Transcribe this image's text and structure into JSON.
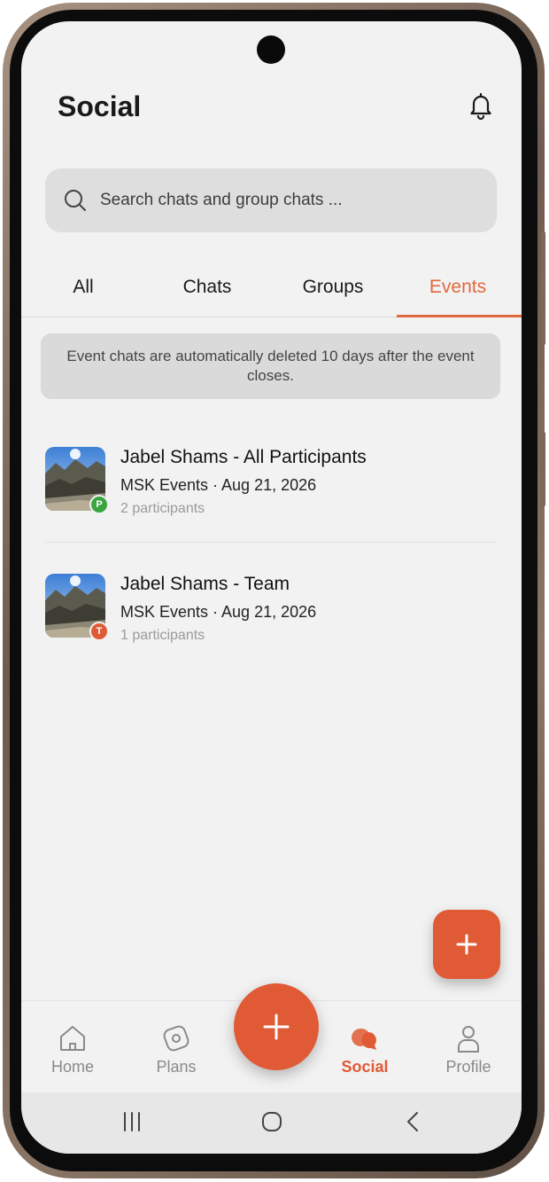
{
  "header": {
    "title": "Social",
    "notification_icon": "bell-icon"
  },
  "search": {
    "placeholder": "Search chats and group chats ...",
    "icon": "search-icon"
  },
  "tabs": [
    {
      "label": "All",
      "active": false
    },
    {
      "label": "Chats",
      "active": false
    },
    {
      "label": "Groups",
      "active": false
    },
    {
      "label": "Events",
      "active": true
    }
  ],
  "notice": {
    "text": "Event chats are automatically deleted 10 days after the event closes."
  },
  "events": [
    {
      "title": "Jabel Shams - All Participants",
      "meta": "MSK Events · Aug 21, 2026",
      "participants": "2 participants",
      "badge": "P",
      "badge_color": "#3aa53f"
    },
    {
      "title": "Jabel Shams - Team",
      "meta": "MSK Events · Aug 21, 2026",
      "participants": "1 participants",
      "badge": "T",
      "badge_color": "#e05a35"
    }
  ],
  "fab_small": {
    "icon": "plus-icon"
  },
  "bottom_nav": {
    "items": [
      {
        "label": "Home",
        "icon": "home-icon",
        "active": false
      },
      {
        "label": "Plans",
        "icon": "compass-icon",
        "active": false
      },
      {
        "label": "Social",
        "icon": "chat-bubbles-icon",
        "active": true
      },
      {
        "label": "Profile",
        "icon": "person-icon",
        "active": false
      }
    ],
    "center_fab_icon": "plus-icon"
  },
  "system_nav": {
    "recent_icon": "recent-apps-icon",
    "home_icon": "home-circle-icon",
    "back_icon": "back-chevron-icon"
  },
  "colors": {
    "accent": "#e05a35",
    "tab_active": "#e2683e",
    "background": "#f2f2f2"
  }
}
